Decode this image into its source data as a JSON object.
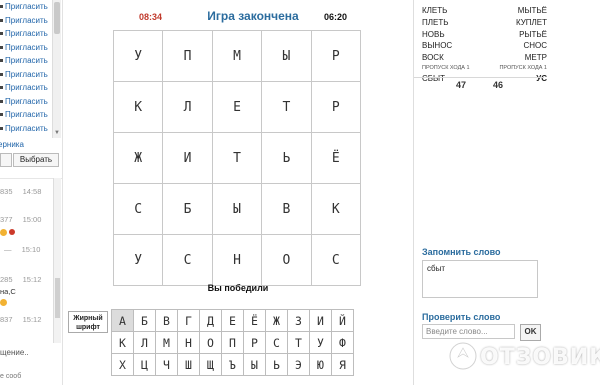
{
  "sidebar": {
    "invite_items": [
      "Пригласить",
      "Пригласить",
      "Пригласить",
      "Пригласить",
      "Пригласить",
      "Пригласить",
      "Пригласить",
      "Пригласить",
      "Пригласить",
      "Пригласить"
    ],
    "friend_link": "ерника",
    "choose_button": "Выбрать",
    "chat": [
      {
        "num": "835",
        "time": "14:58"
      },
      {
        "num": "377",
        "time": "15:00"
      },
      {
        "num": "",
        "time": "15:10"
      },
      {
        "num": "285",
        "time": "15:12"
      },
      {
        "num": "",
        "text": "на,С"
      },
      {
        "num": "837",
        "time": "15:12"
      }
    ],
    "message_placeholder": "щение..",
    "message_placeholder2": "е сооб"
  },
  "game": {
    "timer_left": "08:34",
    "timer_right": "06:20",
    "status_title": "Игра закончена",
    "grid": [
      [
        "У",
        "П",
        "М",
        "Ы",
        "Р"
      ],
      [
        "К",
        "Л",
        "Е",
        "Т",
        "Р"
      ],
      [
        "Ж",
        "И",
        "Т",
        "Ь",
        "Ё"
      ],
      [
        "С",
        "Б",
        "Ы",
        "В",
        "К"
      ],
      [
        "У",
        "С",
        "Н",
        "О",
        "С"
      ]
    ],
    "result_text": "Вы победили",
    "bold_font_label_line1": "Жирный",
    "bold_font_label_line2": "шрифт",
    "keyboard": [
      [
        "А",
        "Б",
        "В",
        "Г",
        "Д",
        "Е",
        "Ё",
        "Ж",
        "З",
        "И",
        "Й"
      ],
      [
        "К",
        "Л",
        "М",
        "Н",
        "О",
        "П",
        "Р",
        "С",
        "Т",
        "У",
        "Ф"
      ],
      [
        "Х",
        "Ц",
        "Ч",
        "Ш",
        "Щ",
        "Ъ",
        "Ы",
        "Ь",
        "Э",
        "Ю",
        "Я"
      ]
    ],
    "keyboard_active": "А"
  },
  "right_panel": {
    "words": [
      {
        "left": "КЛЕТЬ",
        "right": "МЫТЬЁ"
      },
      {
        "left": "ПЛЕТЬ",
        "right": "КУПЛЕТ"
      },
      {
        "left": "НОВЬ",
        "right": "РЫТЬЁ"
      },
      {
        "left": "ВЫНОС",
        "right": "СНОС"
      },
      {
        "left": "ВОСК",
        "right": "МЕТР"
      }
    ],
    "skip_left": "ПРОПУСК ХОДА 1",
    "skip_right": "ПРОПУСК ХОДА 1",
    "last_left": "СБЫТ",
    "last_right": "УС",
    "score_left": "47",
    "score_right": "46",
    "remember_title": "Запомнить слово",
    "remember_value": "сбыт",
    "check_title": "Проверить слово",
    "check_placeholder": "Введите слово...",
    "ok_label": "OK"
  },
  "watermark": {
    "text": "ОТЗОВИК"
  }
}
